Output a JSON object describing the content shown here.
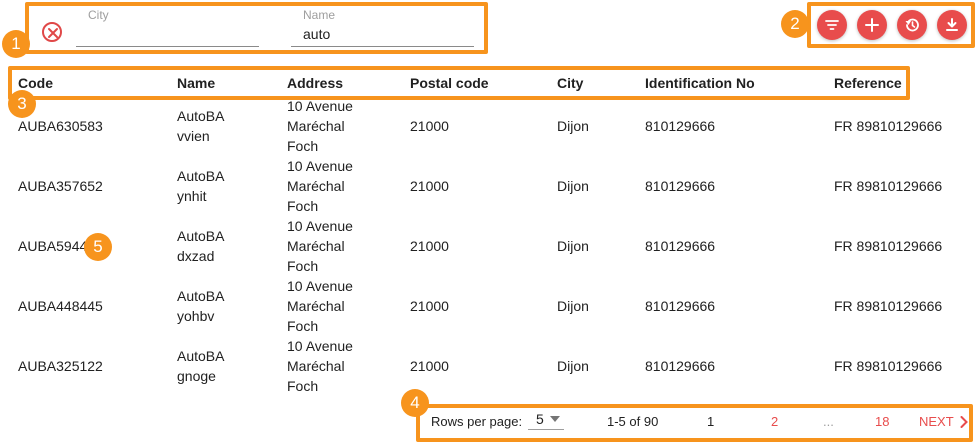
{
  "filters": {
    "city": {
      "label": "City",
      "value": ""
    },
    "name": {
      "label": "Name",
      "value": "auto"
    }
  },
  "actions": [
    "filter-icon",
    "add-icon",
    "history-icon",
    "download-icon"
  ],
  "table": {
    "columns": [
      "Code",
      "Name",
      "Address",
      "Postal code",
      "City",
      "Identification No",
      "Reference"
    ],
    "rows": [
      {
        "code": "AUBA630583",
        "name1": "AutoBA",
        "name2": "vvien",
        "addr1": "10 Avenue",
        "addr2": "Maréchal",
        "addr3": "Foch",
        "postal": "21000",
        "city": "Dijon",
        "ident": "810129666",
        "ref": "FR 89810129666"
      },
      {
        "code": "AUBA357652",
        "name1": "AutoBA",
        "name2": "ynhit",
        "addr1": "10 Avenue",
        "addr2": "Maréchal",
        "addr3": "Foch",
        "postal": "21000",
        "city": "Dijon",
        "ident": "810129666",
        "ref": "FR 89810129666"
      },
      {
        "code": "AUBA5944",
        "name1": "AutoBA",
        "name2": "dxzad",
        "addr1": "10 Avenue",
        "addr2": "Maréchal",
        "addr3": "Foch",
        "postal": "21000",
        "city": "Dijon",
        "ident": "810129666",
        "ref": "FR 89810129666"
      },
      {
        "code": "AUBA448445",
        "name1": "AutoBA",
        "name2": "yohbv",
        "addr1": "10 Avenue",
        "addr2": "Maréchal",
        "addr3": "Foch",
        "postal": "21000",
        "city": "Dijon",
        "ident": "810129666",
        "ref": "FR 89810129666"
      },
      {
        "code": "AUBA325122",
        "name1": "AutoBA",
        "name2": "gnoge",
        "addr1": "10 Avenue",
        "addr2": "Maréchal",
        "addr3": "Foch",
        "postal": "21000",
        "city": "Dijon",
        "ident": "810129666",
        "ref": "FR 89810129666"
      }
    ]
  },
  "pagination": {
    "rows_label": "Rows per page:",
    "rows_value": "5",
    "range": "1-5 of 90",
    "page_current": "1",
    "page_2": "2",
    "ellipsis": "...",
    "page_last": "18",
    "next": "NEXT"
  },
  "callouts": [
    "1",
    "2",
    "3",
    "4",
    "5"
  ],
  "colors": {
    "accent": "#e84c4c",
    "callout": "#f7941d"
  }
}
